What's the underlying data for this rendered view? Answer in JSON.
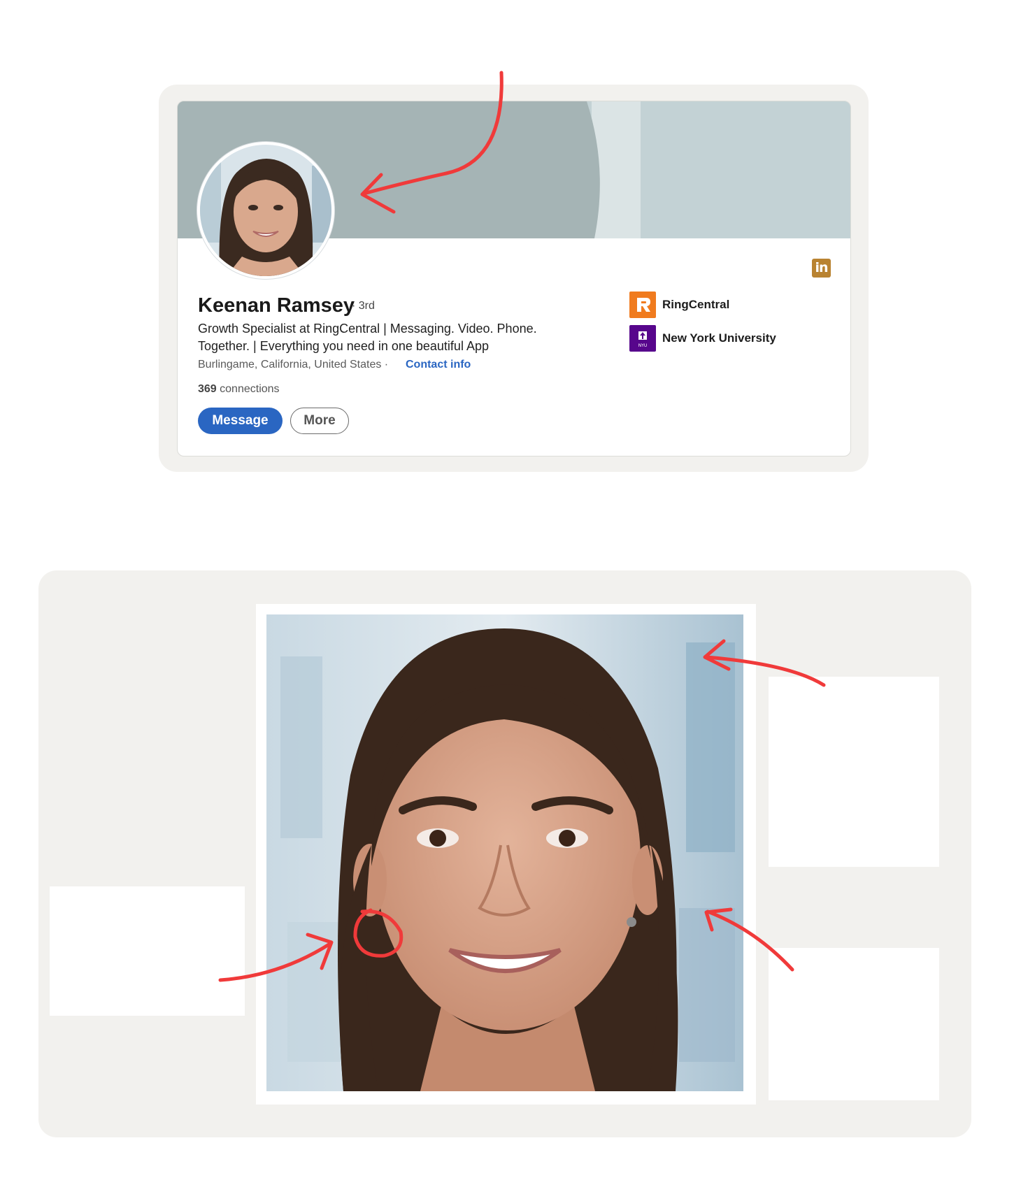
{
  "profile": {
    "name": "Keenan Ramsey",
    "degree": "· 3rd",
    "headline": "Growth Specialist at RingCentral | Messaging. Video. Phone. Together. | Everything you need in one beautiful App",
    "location": "Burlingame, California, United States ·",
    "contact_label": "Contact info",
    "connections_count": "369",
    "connections_label": "connections",
    "buttons": {
      "message": "Message",
      "more": "More"
    },
    "linkedin_icon_text": "in",
    "organizations": [
      {
        "name": "RingCentral",
        "logo_icon": "ringcentral-logo-icon",
        "logo_letter": "R",
        "color": "#f07b1e"
      },
      {
        "name": "New York University",
        "logo_icon": "nyu-logo-icon",
        "logo_letter": "NYU",
        "color": "#57068c"
      }
    ]
  },
  "colors": {
    "accent": "#2a66c2",
    "annotation": "#f03a3a",
    "banner_dark": "#a5b4b5",
    "banner_light": "#c3d2d5",
    "panel_bg": "#f2f1ee"
  }
}
